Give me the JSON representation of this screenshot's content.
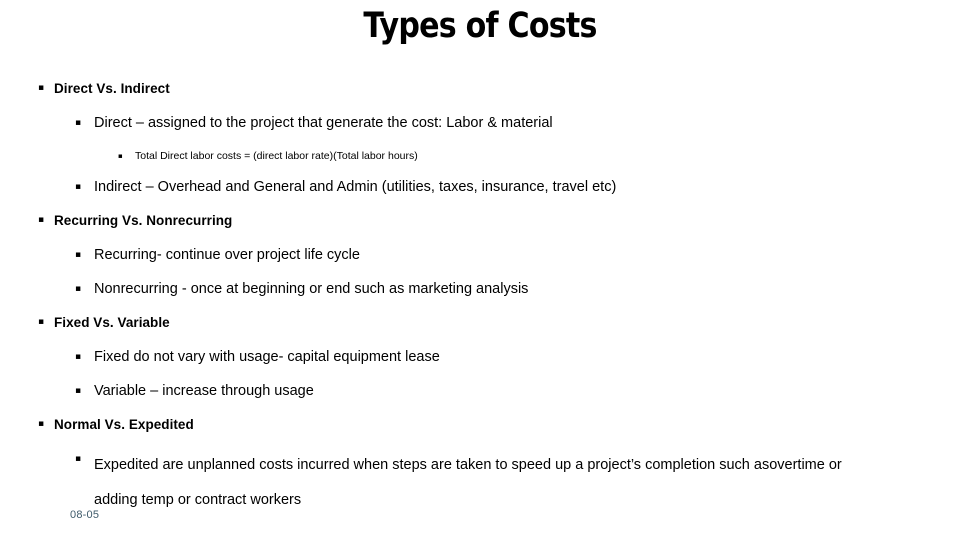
{
  "slide": {
    "title": "Types of Costs",
    "slide_number": "08-05",
    "slide_number_color": "#3f5b6b",
    "bullet_glyph": "▪",
    "background_color": "#ffffff",
    "text_color": "#000000",
    "outline": [
      {
        "level": 1,
        "text": "Direct Vs. Indirect"
      },
      {
        "level": 2,
        "text": "Direct – assigned to the project that generate the cost: Labor & material"
      },
      {
        "level": 3,
        "text": "Total Direct labor costs = (direct labor rate)(Total labor hours)"
      },
      {
        "level": 2,
        "text": "Indirect – Overhead and General and Admin (utilities, taxes, insurance, travel etc)"
      },
      {
        "level": 1,
        "text": "Recurring Vs. Nonrecurring"
      },
      {
        "level": 2,
        "text": "Recurring- continue over project life cycle"
      },
      {
        "level": 2,
        "text": "Nonrecurring - once at beginning or end such as marketing analysis"
      },
      {
        "level": 1,
        "text": "Fixed Vs. Variable"
      },
      {
        "level": 2,
        "text": "Fixed do not vary with usage- capital equipment lease"
      },
      {
        "level": 2,
        "text": "Variable – increase through usage"
      },
      {
        "level": 1,
        "text": "Normal Vs. Expedited"
      },
      {
        "level": 2,
        "text": "Expedited are unplanned costs incurred when steps are taken to speed up a project’s completion such asovertime or adding temp or contract workers",
        "wraps": true
      }
    ]
  }
}
